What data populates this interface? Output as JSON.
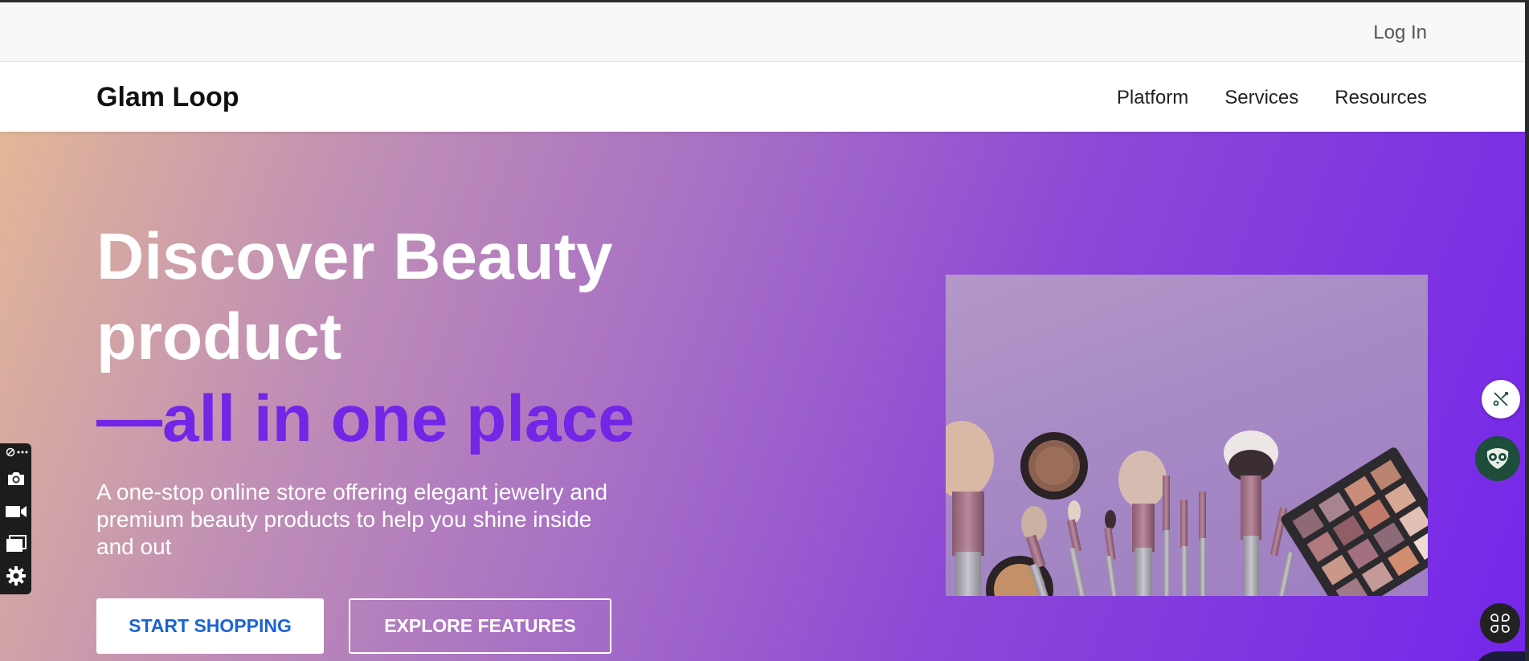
{
  "topbar": {
    "login_label": "Log In"
  },
  "navbar": {
    "brand": "Glam Loop",
    "links": [
      {
        "label": "Platform"
      },
      {
        "label": "Services"
      },
      {
        "label": "Resources"
      }
    ]
  },
  "hero": {
    "headline": "Discover Beauty product",
    "accent": "—all in one place",
    "subtext": "A one-stop online store offering elegant jewelry and premium beauty products to help you shine inside and out",
    "primary_button": "START SHOPPING",
    "secondary_button": "EXPLORE FEATURES",
    "image_alt": "makeup-brushes-and-eyeshadow-palette"
  },
  "side_toolbar": {
    "icons": [
      "pin-icon",
      "more-icon",
      "camera-icon",
      "video-icon",
      "windows-icon",
      "gear-icon"
    ]
  },
  "floating": {
    "icons": [
      "share-icon",
      "owl-icon",
      "apps-icon"
    ]
  },
  "colors": {
    "accent": "#7326e6",
    "primary_button_text": "#1a63d6",
    "gradient_start": "#e2b797",
    "gradient_end": "#7426ea"
  }
}
